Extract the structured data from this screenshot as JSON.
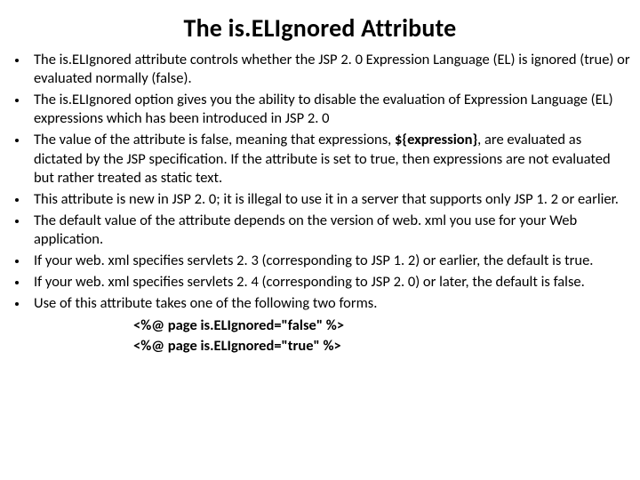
{
  "title": "The is.ELIgnored Attribute",
  "bullets": [
    "The is.ELIgnored attribute controls whether the JSP 2. 0 Expression Language (EL) is ignored (true) or evaluated normally (false).",
    "The is.ELIgnored option gives you the ability to disable the evaluation of Expression Language (EL) expressions which has been introduced in JSP 2. 0",
    "The value of the attribute is false, meaning that expressions, ${expression}, are evaluated as dictated by the JSP specification. If the attribute is set to true, then expressions are not evaluated but rather treated as static text.",
    "This attribute is new in JSP 2. 0; it is illegal to use it in a server that supports only JSP 1. 2 or earlier.",
    "The default value of the attribute depends on the version of web. xml you use for your Web application.",
    "If your web. xml specifies servlets 2. 3 (corresponding to JSP 1. 2) or earlier, the default is true.",
    "If your web. xml specifies servlets 2. 4 (corresponding to JSP 2. 0) or later, the default is false.",
    "Use of this attribute takes one of the following two forms."
  ],
  "code": [
    "<%@ page is.ELIgnored=\"false\" %>",
    "<%@ page is.ELIgnored=\"true\" %>"
  ]
}
